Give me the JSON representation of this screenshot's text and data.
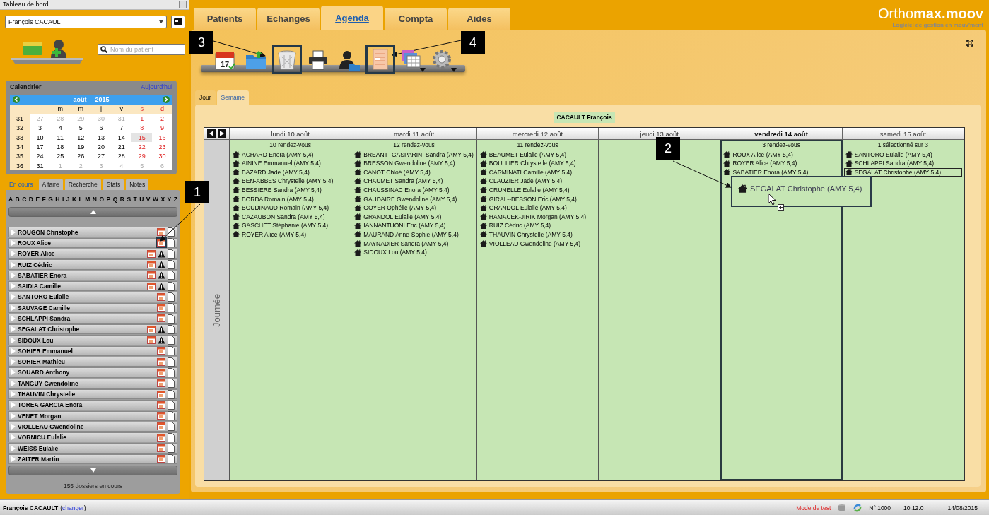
{
  "sidebar": {
    "title": "Tableau de bord",
    "user": "François CACAULT",
    "search": {
      "placeholder": "Nom du patient"
    },
    "calendar": {
      "title": "Calendrier",
      "today_link": "Aujourd'hui",
      "month": "août",
      "year": "2015",
      "weekdays": [
        "l",
        "m",
        "m",
        "j",
        "v",
        "s",
        "d"
      ],
      "weeks": [
        {
          "week": "31",
          "days": [
            {
              "day": "27",
              "other_month": true,
              "selected": false
            },
            {
              "day": "28",
              "other_month": true,
              "selected": false
            },
            {
              "day": "29",
              "other_month": true,
              "selected": false
            },
            {
              "day": "30",
              "other_month": true,
              "selected": false
            },
            {
              "day": "31",
              "other_month": true,
              "selected": false
            },
            {
              "day": "1",
              "other_month": false,
              "selected": false
            },
            {
              "day": "2",
              "other_month": false,
              "selected": false
            }
          ]
        },
        {
          "week": "32",
          "days": [
            {
              "day": "3",
              "other_month": false,
              "selected": false
            },
            {
              "day": "4",
              "other_month": false,
              "selected": false
            },
            {
              "day": "5",
              "other_month": false,
              "selected": false
            },
            {
              "day": "6",
              "other_month": false,
              "selected": false
            },
            {
              "day": "7",
              "other_month": false,
              "selected": false
            },
            {
              "day": "8",
              "other_month": false,
              "selected": false
            },
            {
              "day": "9",
              "other_month": false,
              "selected": false
            }
          ]
        },
        {
          "week": "33",
          "days": [
            {
              "day": "10",
              "other_month": false,
              "selected": false
            },
            {
              "day": "11",
              "other_month": false,
              "selected": false
            },
            {
              "day": "12",
              "other_month": false,
              "selected": false
            },
            {
              "day": "13",
              "other_month": false,
              "selected": false
            },
            {
              "day": "14",
              "other_month": false,
              "selected": false
            },
            {
              "day": "15",
              "other_month": false,
              "selected": true
            },
            {
              "day": "16",
              "other_month": false,
              "selected": false
            }
          ]
        },
        {
          "week": "34",
          "days": [
            {
              "day": "17",
              "other_month": false,
              "selected": false
            },
            {
              "day": "18",
              "other_month": false,
              "selected": false
            },
            {
              "day": "19",
              "other_month": false,
              "selected": false
            },
            {
              "day": "20",
              "other_month": false,
              "selected": false
            },
            {
              "day": "21",
              "other_month": false,
              "selected": false
            },
            {
              "day": "22",
              "other_month": false,
              "selected": false
            },
            {
              "day": "23",
              "other_month": false,
              "selected": false
            }
          ]
        },
        {
          "week": "35",
          "days": [
            {
              "day": "24",
              "other_month": false,
              "selected": false
            },
            {
              "day": "25",
              "other_month": false,
              "selected": false
            },
            {
              "day": "26",
              "other_month": false,
              "selected": false
            },
            {
              "day": "27",
              "other_month": false,
              "selected": false
            },
            {
              "day": "28",
              "other_month": false,
              "selected": false
            },
            {
              "day": "29",
              "other_month": false,
              "selected": false
            },
            {
              "day": "30",
              "other_month": false,
              "selected": false
            }
          ]
        },
        {
          "week": "36",
          "days": [
            {
              "day": "31",
              "other_month": false,
              "selected": false
            },
            {
              "day": "1",
              "other_month": true,
              "selected": false
            },
            {
              "day": "2",
              "other_month": true,
              "selected": false
            },
            {
              "day": "3",
              "other_month": true,
              "selected": false
            },
            {
              "day": "4",
              "other_month": true,
              "selected": false
            },
            {
              "day": "5",
              "other_month": true,
              "selected": false
            },
            {
              "day": "6",
              "other_month": true,
              "selected": false
            }
          ]
        }
      ]
    },
    "tabs": [
      {
        "label": "En cours",
        "selected": true
      },
      {
        "label": "A faire",
        "selected": false
      },
      {
        "label": "Recherche",
        "selected": false
      },
      {
        "label": "Stats",
        "selected": false
      },
      {
        "label": "Notes",
        "selected": false
      }
    ],
    "letters": [
      "A",
      "B",
      "C",
      "D",
      "E",
      "F",
      "G",
      "H",
      "I",
      "J",
      "K",
      "L",
      "M",
      "N",
      "O",
      "P",
      "Q",
      "R",
      "S",
      "T",
      "U",
      "V",
      "W",
      "X",
      "Y",
      "Z"
    ],
    "patients": [
      {
        "name": "ROUGON Christophe",
        "warning": false,
        "calendar_framed": false
      },
      {
        "name": "ROUX Alice",
        "warning": false,
        "calendar_framed": true
      },
      {
        "name": "ROYER Alice",
        "warning": true,
        "calendar_framed": false
      },
      {
        "name": "RUIZ Cédric",
        "warning": true,
        "calendar_framed": false
      },
      {
        "name": "SABATIER Enora",
        "warning": true,
        "calendar_framed": false
      },
      {
        "name": "SAIDIA Camille",
        "warning": true,
        "calendar_framed": false
      },
      {
        "name": "SANTORO Eulalie",
        "warning": false,
        "calendar_framed": false
      },
      {
        "name": "SAUVAGE Camille",
        "warning": false,
        "calendar_framed": false
      },
      {
        "name": "SCHLAPPI Sandra",
        "warning": false,
        "calendar_framed": false
      },
      {
        "name": "SEGALAT Christophe",
        "warning": true,
        "calendar_framed": false
      },
      {
        "name": "SIDOUX Lou",
        "warning": true,
        "calendar_framed": false
      },
      {
        "name": "SOHIER Emmanuel",
        "warning": false,
        "calendar_framed": false
      },
      {
        "name": "SOHIER Mathieu",
        "warning": false,
        "calendar_framed": false
      },
      {
        "name": "SOUARD Anthony",
        "warning": false,
        "calendar_framed": false
      },
      {
        "name": "TANGUY Gwendoline",
        "warning": false,
        "calendar_framed": false
      },
      {
        "name": "THAUVIN Chrystelle",
        "warning": false,
        "calendar_framed": false
      },
      {
        "name": "TOREA GARCIA Enora",
        "warning": false,
        "calendar_framed": false
      },
      {
        "name": "VENET Morgan",
        "warning": false,
        "calendar_framed": false
      },
      {
        "name": "VIOLLEAU Gwendoline",
        "warning": false,
        "calendar_framed": false
      },
      {
        "name": "VORNICU Eulalie",
        "warning": false,
        "calendar_framed": false
      },
      {
        "name": "WEISS Eulalie",
        "warning": false,
        "calendar_framed": false
      },
      {
        "name": "ZAITER Martin",
        "warning": false,
        "calendar_framed": false
      }
    ],
    "footer": "155 dossiers en cours"
  },
  "main_tabs": [
    {
      "label": "Patients",
      "selected": false
    },
    {
      "label": "Echanges",
      "selected": false
    },
    {
      "label": "Agenda",
      "selected": true
    },
    {
      "label": "Compta",
      "selected": false
    },
    {
      "label": "Aides",
      "selected": false
    }
  ],
  "logo": {
    "text": "Ortho**max.moov**",
    "tagline": "Logiciel de gestion en mouv'ment"
  },
  "toolbar": [
    {
      "kind": "calendar",
      "label": "17",
      "framed": false
    },
    {
      "kind": "folder",
      "framed": false
    },
    {
      "kind": "trash",
      "framed": true
    },
    {
      "kind": "printer",
      "framed": false
    },
    {
      "kind": "person",
      "framed": false
    },
    {
      "kind": "form",
      "framed": true
    },
    {
      "kind": "grid",
      "framed": false,
      "dropdown": true
    },
    {
      "kind": "gear",
      "framed": false,
      "dropdown": true
    }
  ],
  "view_tabs": [
    {
      "label": "Jour",
      "selected": false
    },
    {
      "label": "Semaine",
      "selected": true
    }
  ],
  "agenda": {
    "owner": "CACAULT François",
    "side_label": "Journée",
    "days": [
      {
        "header": "lundi 10 août",
        "selected": false,
        "summary": "10 rendez-vous",
        "appointments": [
          {
            "text": "ACHARD Enora (AMY 5,4)",
            "selected": false
          },
          {
            "text": "AININE Emmanuel (AMY 5,4)",
            "selected": false
          },
          {
            "text": "BAZARD Jade (AMY 5,4)",
            "selected": false
          },
          {
            "text": "BEN-ABBES Chrystelle (AMY 5,4)",
            "selected": false
          },
          {
            "text": "BESSIERE Sandra (AMY 5,4)",
            "selected": false
          },
          {
            "text": "BORDA Romain (AMY 5,4)",
            "selected": false
          },
          {
            "text": "BOUDINAUD Romain (AMY 5,4)",
            "selected": false
          },
          {
            "text": "CAZAUBON Sandra (AMY 5,4)",
            "selected": false
          },
          {
            "text": "GASCHET Stéphanie (AMY 5,4)",
            "selected": false
          },
          {
            "text": "ROYER Alice (AMY 5,4)",
            "selected": false
          }
        ]
      },
      {
        "header": "mardi 11 août",
        "selected": false,
        "summary": "12 rendez-vous",
        "appointments": [
          {
            "text": "BREANT--GASPARINI Sandra (AMY 5,4)",
            "selected": false
          },
          {
            "text": "BRESSON Gwendoline (AMY 5,4)",
            "selected": false
          },
          {
            "text": "CANOT Chloé (AMY 5,4)",
            "selected": false
          },
          {
            "text": "CHAUMET Sandra (AMY 5,4)",
            "selected": false
          },
          {
            "text": "CHAUSSINAC Enora (AMY 5,4)",
            "selected": false
          },
          {
            "text": "GAUDAIRE Gwendoline (AMY 5,4)",
            "selected": false
          },
          {
            "text": "GOYER Ophélie (AMY 5,4)",
            "selected": false
          },
          {
            "text": "GRANDOL Eulalie (AMY 5,4)",
            "selected": false
          },
          {
            "text": "IANNANTUONI Eric (AMY 5,4)",
            "selected": false
          },
          {
            "text": "MAURAND Anne-Sophie (AMY 5,4)",
            "selected": false
          },
          {
            "text": "MAYNADIER Sandra (AMY 5,4)",
            "selected": false
          },
          {
            "text": "SIDOUX Lou (AMY 5,4)",
            "selected": false
          }
        ]
      },
      {
        "header": "mercredi 12 août",
        "selected": false,
        "summary": "11 rendez-vous",
        "appointments": [
          {
            "text": "BEAUMET Eulalie (AMY 5,4)",
            "selected": false
          },
          {
            "text": "BOULLIER Chrystelle (AMY 5,4)",
            "selected": false
          },
          {
            "text": "CARMINATI Camille (AMY 5,4)",
            "selected": false
          },
          {
            "text": "CLAUZIER Jade (AMY 5,4)",
            "selected": false
          },
          {
            "text": "CRUNELLE Eulalie (AMY 5,4)",
            "selected": false
          },
          {
            "text": "GIRAL--BESSON Eric (AMY 5,4)",
            "selected": false
          },
          {
            "text": "GRANDOL Eulalie (AMY 5,4)",
            "selected": false
          },
          {
            "text": "HAMACEK-JIRIK Morgan (AMY 5,4)",
            "selected": false
          },
          {
            "text": "RUIZ Cédric (AMY 5,4)",
            "selected": false
          },
          {
            "text": "THAUVIN Chrystelle (AMY 5,4)",
            "selected": false
          },
          {
            "text": "VIOLLEAU Gwendoline (AMY 5,4)",
            "selected": false
          }
        ]
      },
      {
        "header": "jeudi 13 août",
        "selected": false
      },
      {
        "header": "vendredi 14 août",
        "selected": true,
        "summary": "3 rendez-vous",
        "appointments": [
          {
            "text": "ROUX Alice (AMY 5,4)",
            "selected": false
          },
          {
            "text": "ROYER Alice (AMY 5,4)",
            "selected": false
          },
          {
            "text": "SABATIER Enora (AMY 5,4)",
            "selected": false
          }
        ]
      },
      {
        "header": "samedi 15 août",
        "selected": false,
        "summary": "1 sélectionné sur 3",
        "appointments": [
          {
            "text": "SANTORO Eulalie (AMY 5,4)",
            "selected": false
          },
          {
            "text": "SCHLAPPI Sandra (AMY 5,4)",
            "selected": false
          },
          {
            "text": "SEGALAT Christophe (AMY 5,4)",
            "selected": true
          }
        ]
      }
    ],
    "drag_preview": {
      "text": "SEGALAT Christophe (AMY 5,4)"
    }
  },
  "callouts": [
    {
      "number": "1"
    },
    {
      "number": "2"
    },
    {
      "number": "3"
    },
    {
      "number": "4"
    }
  ],
  "status_bar": {
    "user": "François CACAULT",
    "paren_open": "(",
    "change_link": "changer",
    "paren_close": ")",
    "mode": "Mode de test",
    "number": "N° 1000",
    "version": "10.12.0",
    "date": "14/08/2015"
  }
}
